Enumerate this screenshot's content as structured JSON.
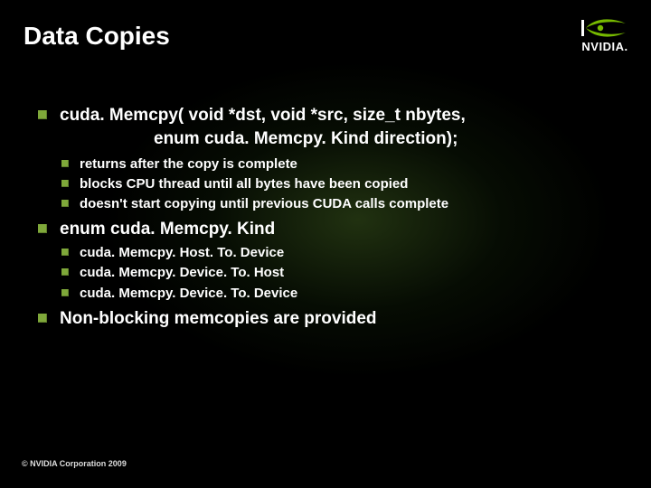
{
  "title": "Data Copies",
  "brand": "NVIDIA.",
  "signature": {
    "line1": "cuda. Memcpy( void *dst,   void *src,   size_t nbytes,",
    "line2": "enum cuda. Memcpy. Kind direction);"
  },
  "sig_notes": [
    "returns after the copy is complete",
    "blocks CPU thread until all bytes have been copied",
    "doesn't start copying until previous CUDA calls complete"
  ],
  "enum_header": "enum cuda. Memcpy. Kind",
  "enum_values": [
    "cuda. Memcpy. Host. To. Device",
    "cuda. Memcpy. Device. To. Host",
    "cuda. Memcpy. Device. To. Device"
  ],
  "nonblocking": "Non-blocking memcopies are provided",
  "footer": "© NVIDIA Corporation 2009"
}
